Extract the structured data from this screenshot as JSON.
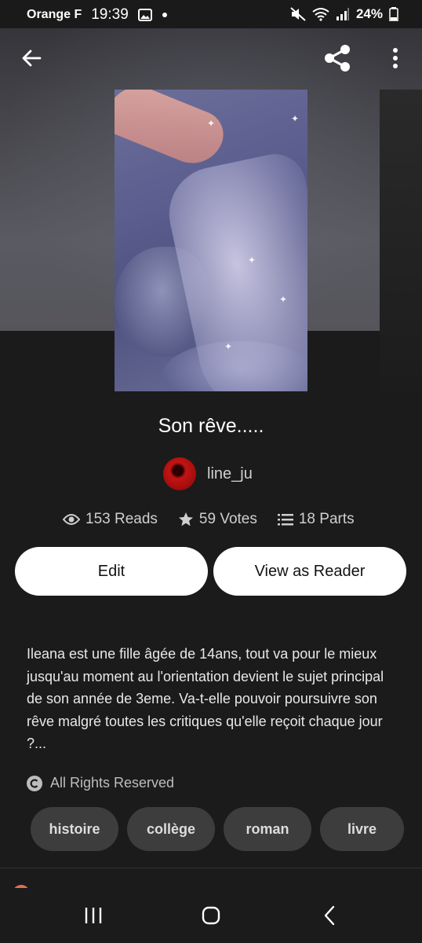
{
  "status_bar": {
    "carrier": "Orange F",
    "time": "19:39",
    "battery": "24%"
  },
  "book": {
    "title": "Son rêve.....",
    "author": "line_ju",
    "stats": {
      "reads": "153 Reads",
      "votes": "59 Votes",
      "parts": "18 Parts"
    },
    "description": "Ileana est une fille âgée de 14ans, tout va pour le mieux jusqu'au moment au l'orientation devient le sujet principal de son année de 3eme. Va-t-elle pouvoir poursuivre son rêve malgré toutes les critiques qu'elle reçoit chaque jour ?...",
    "rights": "All Rights Reserved",
    "tags": [
      "histoire",
      "collège",
      "roman",
      "livre"
    ]
  },
  "actions": {
    "edit_label": "Edit",
    "reader_label": "View as Reader"
  },
  "icons": {
    "back": "arrow-left-icon",
    "share": "share-icon",
    "more": "more-vertical-icon",
    "reads": "eye-icon",
    "votes": "star-icon",
    "parts": "list-icon",
    "rights": "copyright-icon"
  },
  "colors": {
    "background": "#1c1c1c",
    "button_bg": "#ffffff",
    "tag_bg": "#3d3d3d"
  }
}
